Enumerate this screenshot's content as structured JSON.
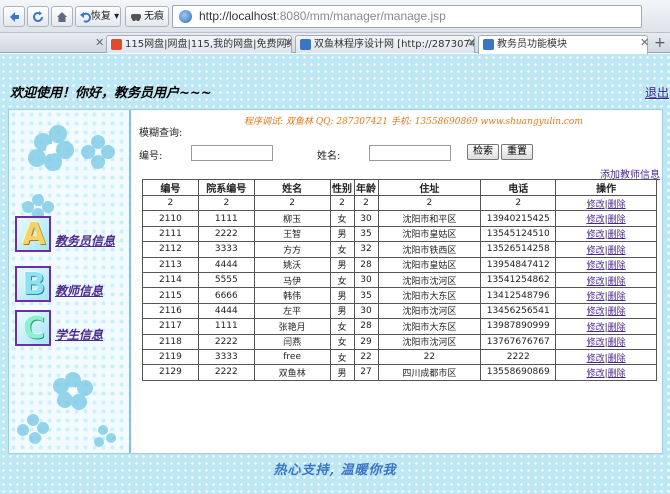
{
  "browser": {
    "back_label": "",
    "forward_label": "",
    "favorites_label": "收藏",
    "no_trace_label": "无痕",
    "url_host": "http://localhost",
    "url_rest": ":8080/mm/manager/manage.jsp",
    "tabs": [
      {
        "label": "115网盘|网盘|115,我的网盘|免费网络..."
      },
      {
        "label": "双鱼林程序设计网 [http://28730742..."
      },
      {
        "label": "教务员功能模块"
      }
    ],
    "new_tab_label": "+"
  },
  "header": {
    "welcome": "欢迎使用！你好，教务员用户~~~",
    "logout": "退出"
  },
  "sidebar": {
    "items": [
      {
        "letter": "A",
        "label": "教务员信息"
      },
      {
        "letter": "B",
        "label": "教师信息"
      },
      {
        "letter": "C",
        "label": "学生信息"
      }
    ]
  },
  "main": {
    "slogan": "程序调试: 双鱼林   QQ: 287307421   手机: 13558690869   www.shuangyulin.com",
    "search_title": "模糊查询:",
    "id_label": "编号:",
    "id_value": "",
    "name_label": "姓名:",
    "name_value": "",
    "search_button": "检索",
    "reset_button": "重置",
    "add_link": "添加教师信息",
    "columns": [
      "编号",
      "院系编号",
      "姓名",
      "性别",
      "年龄",
      "住址",
      "电话",
      "操作"
    ],
    "edit_label": "修改",
    "delete_label": "删除",
    "rows": [
      [
        "2",
        "2",
        "2",
        "2",
        "2",
        "2",
        "2"
      ],
      [
        "2110",
        "1111",
        "柳玉",
        "女",
        "30",
        "沈阳市和平区",
        "13940215425"
      ],
      [
        "2111",
        "2222",
        "王智",
        "男",
        "35",
        "沈阳市皇姑区",
        "13545124510"
      ],
      [
        "2112",
        "3333",
        "方方",
        "女",
        "32",
        "沈阳市铁西区",
        "13526514258"
      ],
      [
        "2113",
        "4444",
        "姚沃",
        "男",
        "28",
        "沈阳市皇姑区",
        "13954847412"
      ],
      [
        "2114",
        "5555",
        "马伊",
        "女",
        "30",
        "沈阳市沈河区",
        "13541254862"
      ],
      [
        "2115",
        "6666",
        "韩伟",
        "男",
        "35",
        "沈阳市大东区",
        "13412548796"
      ],
      [
        "2116",
        "4444",
        "左平",
        "男",
        "30",
        "沈阳市沈河区",
        "13456256541"
      ],
      [
        "2117",
        "1111",
        "张艳月",
        "女",
        "28",
        "沈阳市大东区",
        "13987890999"
      ],
      [
        "2118",
        "2222",
        "闫燕",
        "女",
        "29",
        "沈阳市沈河区",
        "13767676767"
      ],
      [
        "2119",
        "3333",
        "free",
        "女",
        "22",
        "22",
        "2222"
      ],
      [
        "2129",
        "2222",
        "双鱼林",
        "男",
        "27",
        "四川成都市区",
        "13558690869"
      ]
    ]
  },
  "footer": {
    "text": "热心支持, 温暖你我"
  },
  "colors": {
    "page_bg": "#bde7f2",
    "link": "#4d2a8f",
    "slogan": "#e07a1a",
    "footer": "#3a74c9"
  }
}
